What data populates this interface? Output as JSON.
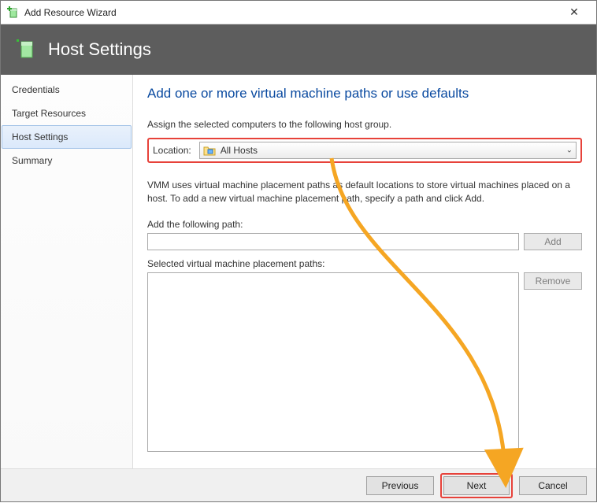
{
  "window": {
    "title": "Add Resource Wizard"
  },
  "header": {
    "title": "Host Settings"
  },
  "sidebar": {
    "items": [
      {
        "label": "Credentials",
        "active": false
      },
      {
        "label": "Target Resources",
        "active": false
      },
      {
        "label": "Host Settings",
        "active": true
      },
      {
        "label": "Summary",
        "active": false
      }
    ]
  },
  "main": {
    "heading": "Add one or more virtual machine paths or use defaults",
    "assign_text": "Assign the selected computers to the following host group.",
    "location_label": "Location:",
    "location_value": "All Hosts",
    "description": "VMM uses virtual machine placement paths as default locations to store virtual machines placed on a host. To add a new virtual machine placement path, specify a path and click Add.",
    "add_path_label": "Add the following path:",
    "add_button": "Add",
    "selected_label": "Selected virtual machine placement paths:",
    "remove_button": "Remove",
    "path_input_value": ""
  },
  "footer": {
    "previous": "Previous",
    "next": "Next",
    "cancel": "Cancel"
  }
}
